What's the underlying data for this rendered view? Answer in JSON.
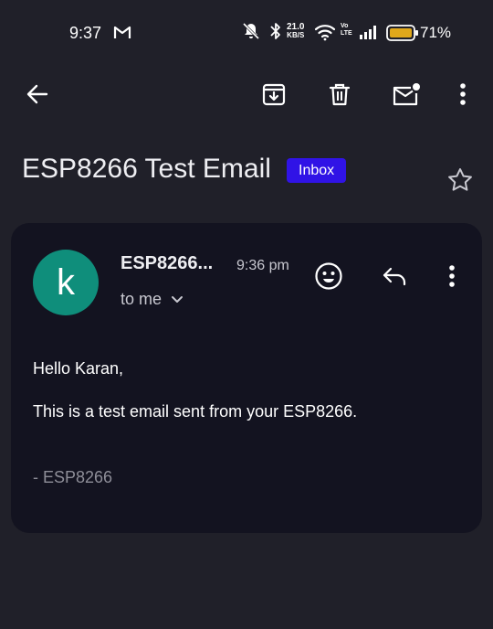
{
  "status_bar": {
    "time": "9:37",
    "net_speed_value": "21.0",
    "net_speed_unit": "KB/S",
    "volte_top": "Vo",
    "volte_bottom": "LTE",
    "battery_percent": "71%",
    "icons": [
      "gmail-notification-icon",
      "mute-icon",
      "bluetooth-icon",
      "wifi-icon",
      "signal-icon",
      "battery-icon"
    ]
  },
  "app_bar": {
    "icons": [
      "back-arrow-icon",
      "archive-icon",
      "delete-icon",
      "mark-unread-icon",
      "more-vert-icon"
    ]
  },
  "email": {
    "subject": "ESP8266 Test Email",
    "label": "Inbox",
    "sender_initial": "k",
    "sender_name": "ESP8266...",
    "time": "9:36 pm",
    "recipient": "to me",
    "greeting": "Hello Karan,",
    "body": "This is a test email sent from your ESP8266.",
    "signature": "- ESP8266"
  },
  "colors": {
    "background": "#202029",
    "card": "#131320",
    "label_badge": "#3013e6",
    "avatar": "#0f8e7b",
    "battery": "#e0a81b"
  }
}
